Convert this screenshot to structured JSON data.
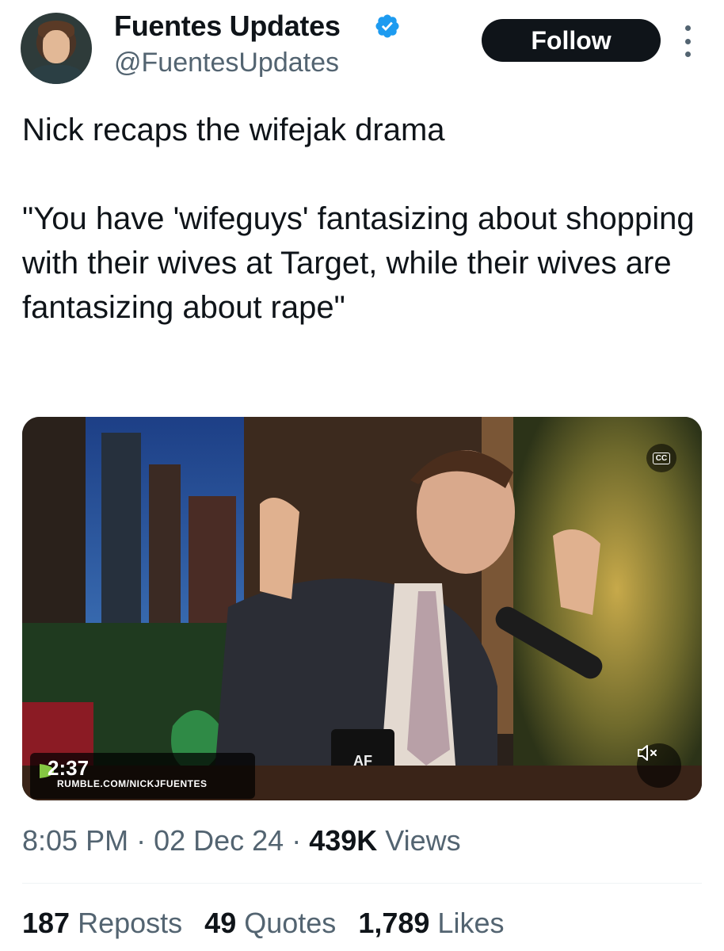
{
  "author": {
    "name": "Fuentes Updates",
    "handle": "@FuentesUpdates",
    "verified": true
  },
  "actions": {
    "follow_label": "Follow"
  },
  "tweet": {
    "text": "Nick recaps the wifejak drama\n\n\"You have 'wifeguys' fantasizing about shopping with their wives at Target, while their wives are fantasizing about rape\""
  },
  "media": {
    "duration": "2:37",
    "source": "RUMBLE.COM/NICKJFUENTES",
    "cc_label": "CC",
    "mug_logo": "AF"
  },
  "meta": {
    "time": "8:05 PM",
    "date": "02 Dec 24",
    "views_count": "439K",
    "views_label": "Views"
  },
  "stats": {
    "reposts_count": "187",
    "reposts_label": "Reposts",
    "quotes_count": "49",
    "quotes_label": "Quotes",
    "likes_count": "1,789",
    "likes_label": "Likes"
  },
  "colors": {
    "text_primary": "#0f1419",
    "text_secondary": "#536471",
    "verified_blue": "#1d9bf0",
    "button_bg": "#0f1419"
  }
}
